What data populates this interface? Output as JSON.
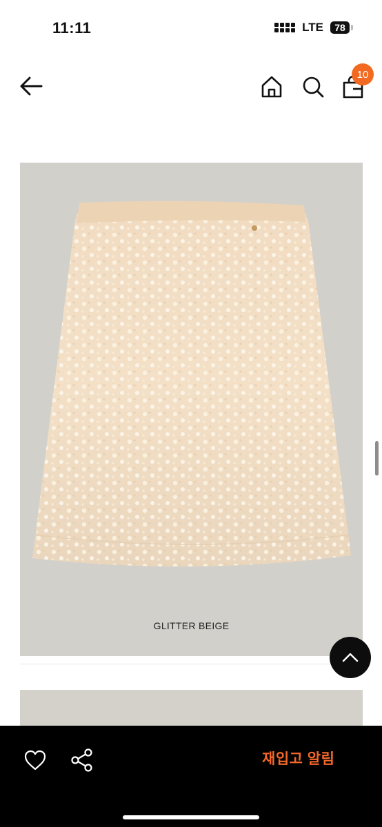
{
  "status_bar": {
    "time": "11:11",
    "network": "LTE",
    "battery": "78"
  },
  "nav": {
    "back_icon": "arrow-left-icon",
    "home_icon": "home-icon",
    "search_icon": "search-icon",
    "cart_icon": "shopping-bag-icon",
    "cart_count": "10",
    "badge_color": "#f26a21"
  },
  "product": {
    "color_label": "GLITTER BEIGE",
    "image_description_icon": "sequin-skirt-image"
  },
  "scroll_top_icon": "chevron-up-icon",
  "bottom_bar": {
    "like_icon": "heart-icon",
    "share_icon": "share-icon",
    "restock_label": "재입고 알림",
    "accent_color": "#f4682a"
  }
}
